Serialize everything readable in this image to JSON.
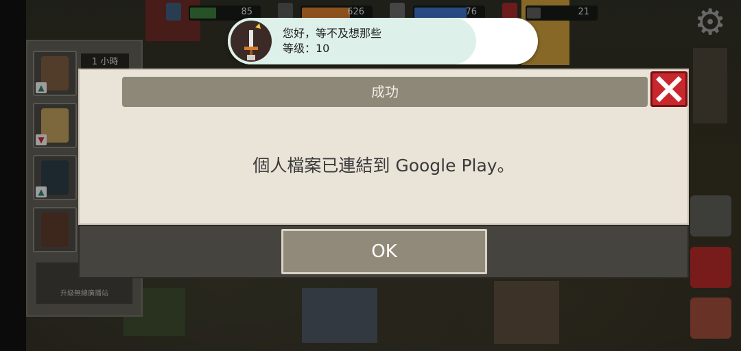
{
  "resources": {
    "food": "85",
    "materials": "626",
    "water": "76",
    "fuel": "21"
  },
  "roster": {
    "time_remaining": "1 小時",
    "radio_upgrade_label": "升級無線廣播站"
  },
  "toast": {
    "greeting": "您好，等不及想那些",
    "level": "等级：10"
  },
  "dialog": {
    "title": "成功",
    "message": "個人檔案已連結到 Google Play。",
    "ok_label": "OK"
  },
  "colors": {
    "accent_red": "#c8272d",
    "food_bar": "#3a7a3a",
    "materials_bar": "#d0782a",
    "water_bar": "#3a6fc0"
  }
}
